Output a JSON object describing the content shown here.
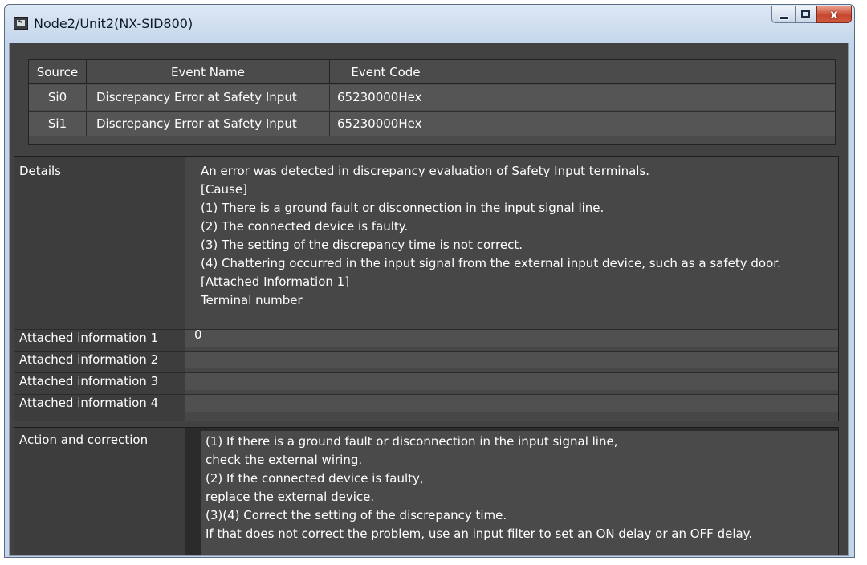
{
  "window": {
    "title": "Node2/Unit2(NX-SID800)",
    "icon": "app-icon",
    "controls": {
      "minimize": "minimize-icon",
      "maximize": "maximize-icon",
      "close": "x"
    }
  },
  "event_table": {
    "headers": [
      "Source",
      "Event Name",
      "Event Code"
    ],
    "rows": [
      {
        "source": "Si0",
        "event_name": "Discrepancy Error at Safety Input",
        "event_code": "65230000Hex"
      },
      {
        "source": "Si1",
        "event_name": "Discrepancy Error at Safety Input",
        "event_code": "65230000Hex"
      }
    ]
  },
  "details": {
    "label": "Details",
    "lines": [
      "An error was detected in discrepancy evaluation of Safety Input terminals.",
      "[Cause]",
      "(1) There is a ground fault or disconnection in the input signal line.",
      "(2) The connected device is faulty.",
      "(3) The setting of the discrepancy time is not correct.",
      "(4) Chattering occurred in the input signal from the external input device, such as a safety door.",
      "[Attached Information 1]",
      "Terminal number"
    ]
  },
  "attached_info": [
    {
      "label": "Attached information 1",
      "value": "0"
    },
    {
      "label": "Attached information 2",
      "value": ""
    },
    {
      "label": "Attached information 3",
      "value": ""
    },
    {
      "label": "Attached information 4",
      "value": ""
    }
  ],
  "action": {
    "label": "Action and correction",
    "lines": [
      "(1) If there is a ground fault or disconnection in the input signal line,",
      "check the external wiring.",
      "(2) If the connected device is faulty,",
      "replace the external device.",
      "(3)(4) Correct the setting of the discrepancy time.",
      "If that does not correct the problem, use an input filter to set an ON delay or an OFF delay."
    ]
  }
}
